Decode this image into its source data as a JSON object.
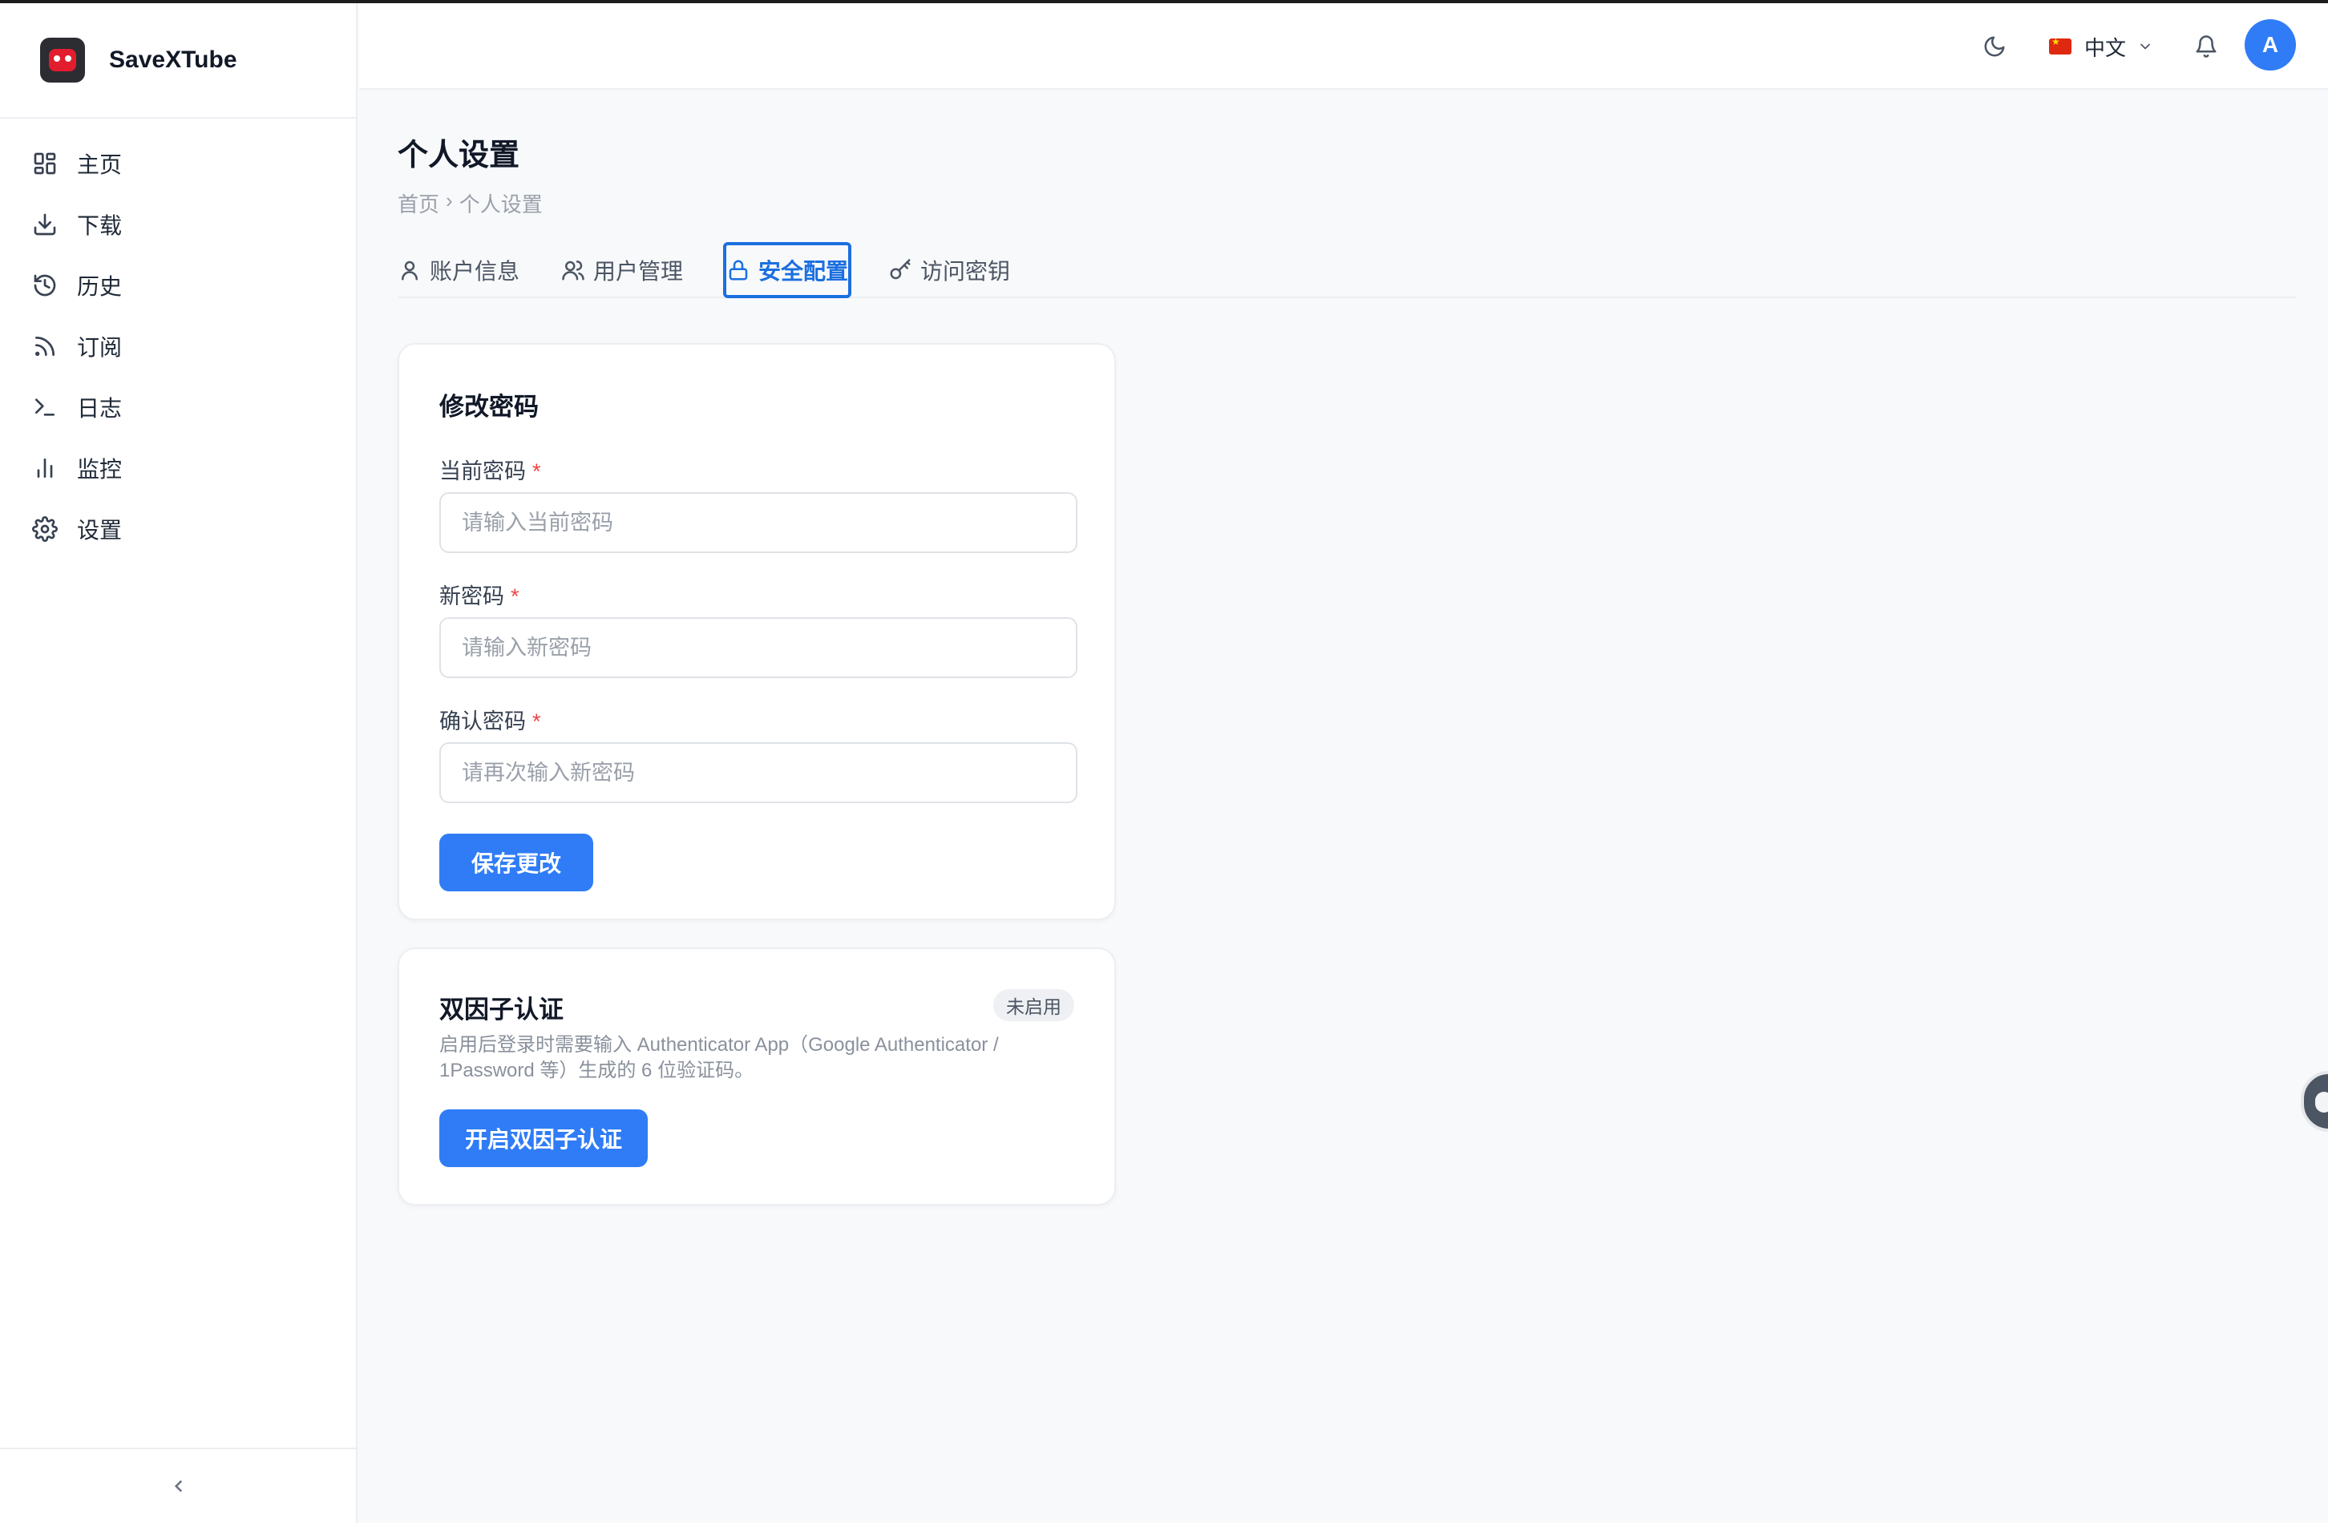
{
  "app": {
    "name": "SaveXTube"
  },
  "sidebar": {
    "items": [
      {
        "label": "主页",
        "icon": "dashboard-icon"
      },
      {
        "label": "下载",
        "icon": "download-icon"
      },
      {
        "label": "历史",
        "icon": "history-icon"
      },
      {
        "label": "订阅",
        "icon": "rss-icon"
      },
      {
        "label": "日志",
        "icon": "terminal-icon"
      },
      {
        "label": "监控",
        "icon": "bar-chart-icon"
      },
      {
        "label": "设置",
        "icon": "gear-icon"
      }
    ]
  },
  "header": {
    "language": "中文",
    "avatar_initial": "A"
  },
  "page": {
    "title": "个人设置",
    "breadcrumb": [
      "首页",
      "›",
      "个人设置"
    ]
  },
  "tabs": [
    {
      "label": "账户信息",
      "active": false
    },
    {
      "label": "用户管理",
      "active": false
    },
    {
      "label": "安全配置",
      "active": true
    },
    {
      "label": "访问密钥",
      "active": false
    }
  ],
  "password_card": {
    "title": "修改密码",
    "current": {
      "label": "当前密码",
      "required_mark": "*",
      "placeholder": "请输入当前密码",
      "value": ""
    },
    "new": {
      "label": "新密码",
      "required_mark": "*",
      "placeholder": "请输入新密码",
      "value": ""
    },
    "confirm": {
      "label": "确认密码",
      "required_mark": "*",
      "placeholder": "请再次输入新密码",
      "value": ""
    },
    "save_label": "保存更改"
  },
  "twofa_card": {
    "title": "双因子认证",
    "status": "未启用",
    "description": "启用后登录时需要输入 Authenticator App（Google Authenticator / 1Password 等）生成的 6 位验证码。",
    "enable_label": "开启双因子认证"
  },
  "colors": {
    "accent": "#2f7cf6",
    "active_tab": "#1b6fe0",
    "required": "#ef4444"
  }
}
